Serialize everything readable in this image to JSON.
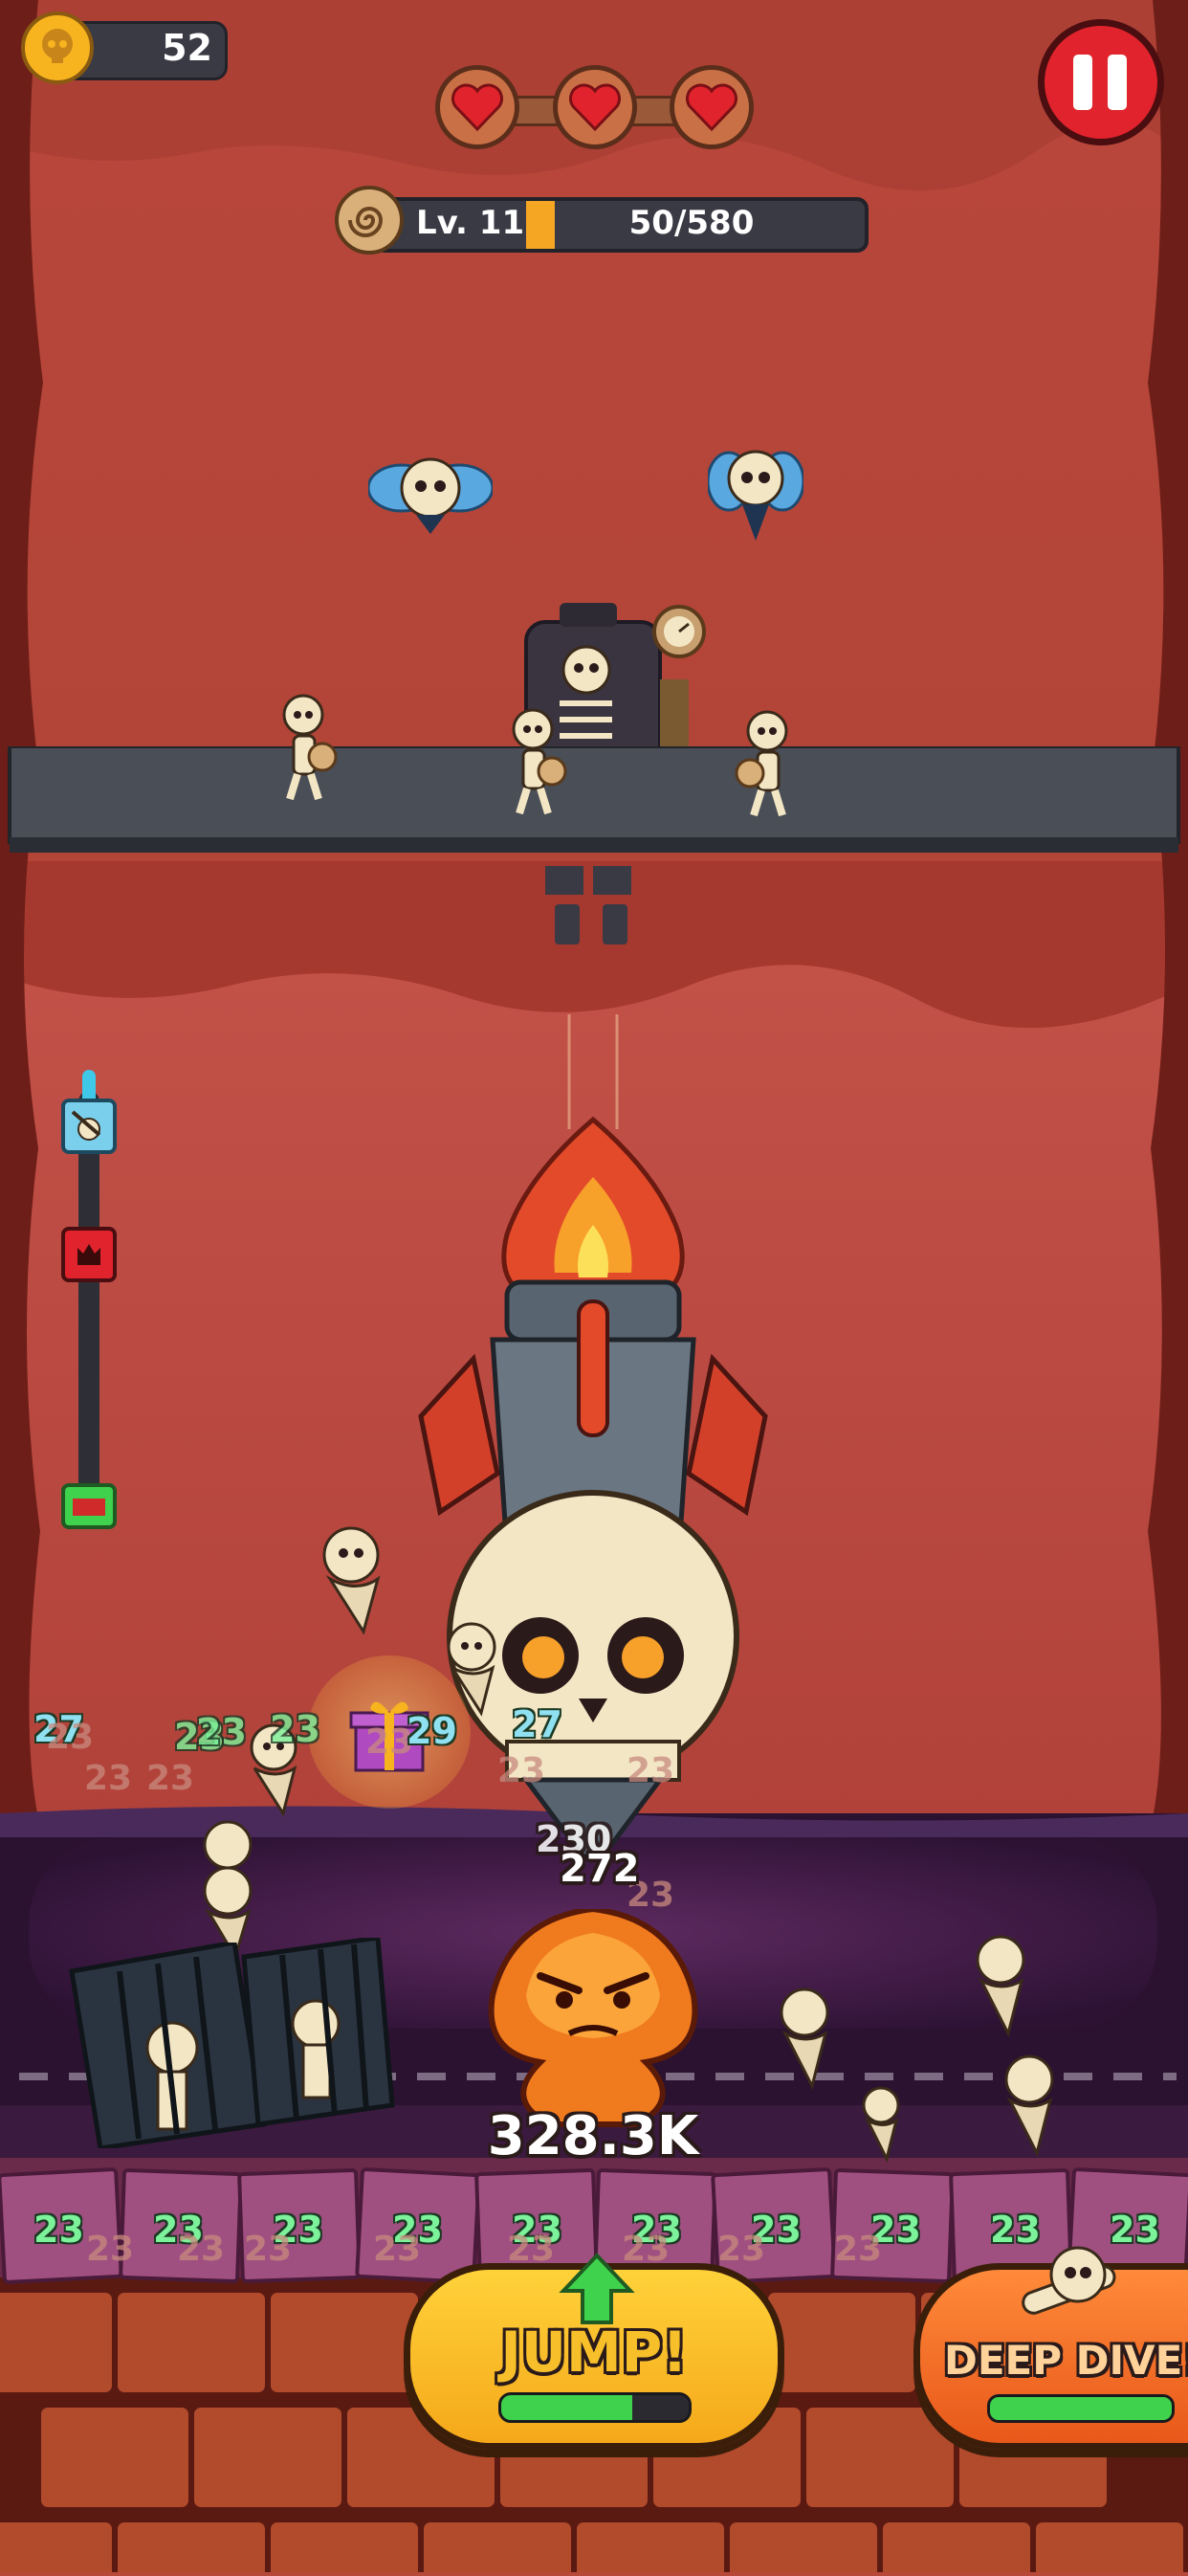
{
  "hud": {
    "coins": "52",
    "hearts": 3,
    "level_label": "Lv. 11",
    "xp_text": "50/580",
    "xp_progress": 0.086
  },
  "depth_meter": {
    "progress": 0.0
  },
  "boss": {
    "hp_text": "328.3K",
    "damage_top": "272",
    "damage_back": "230"
  },
  "floating_numbers": {
    "left": [
      "27",
      "23",
      "23",
      "23",
      "23",
      "23",
      "23",
      "23",
      "29",
      "27"
    ],
    "mid": [
      "23",
      "23",
      "23"
    ]
  },
  "tiles": [
    "23",
    "23",
    "23",
    "23",
    "23",
    "23",
    "23",
    "23",
    "23",
    "23"
  ],
  "tiles_faded": [
    "23",
    "23",
    "23",
    "23",
    "23",
    "23",
    "23",
    "23"
  ],
  "buttons": {
    "jump_label": "JUMP!",
    "jump_progress": 0.7,
    "deep_dive_label": "DEEP DIVE!",
    "deep_dive_progress": 1.0
  },
  "colors": {
    "accent_yellow": "#f7b41f",
    "pause_red": "#e0232c",
    "xp_fill": "#f5a623",
    "jump_green": "#3fd24c"
  }
}
